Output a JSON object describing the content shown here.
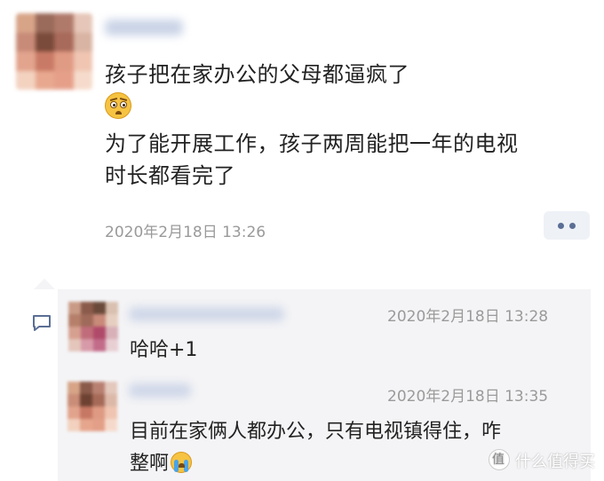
{
  "post": {
    "line1": "孩子把在家办公的父母都逼疯了",
    "line2": "为了能开展工作，孩子两周能把一年的电视",
    "line3": "时长都看完了",
    "emoji": "astonished-face-icon",
    "timestamp": "2020年2月18日 13:26"
  },
  "comments": [
    {
      "text": "哈哈+1",
      "timestamp": "2020年2月18日 13:28"
    },
    {
      "text_line1": "目前在家俩人都办公，只有电视镇得住，咋",
      "text_line2": "整啊",
      "emoji": "crying-face-icon",
      "timestamp": "2020年2月18日 13:35"
    }
  ],
  "watermark": "什么值得买",
  "colors": {
    "comment_bg": "#f4f4f6",
    "timestamp": "#9a9a9a",
    "more_dots": "#5b6f95"
  }
}
